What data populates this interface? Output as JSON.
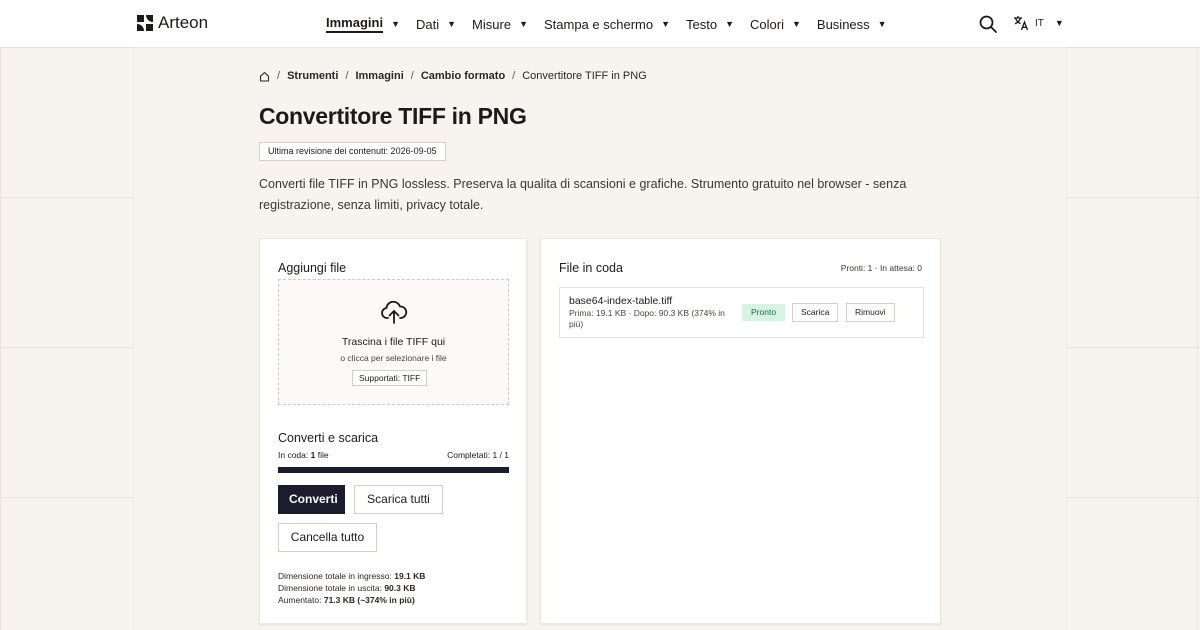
{
  "header": {
    "brand": "Arteon",
    "nav": [
      {
        "label": "Immagini",
        "active": true
      },
      {
        "label": "Dati",
        "active": false
      },
      {
        "label": "Misure",
        "active": false
      },
      {
        "label": "Stampa e schermo",
        "active": false
      },
      {
        "label": "Testo",
        "active": false
      },
      {
        "label": "Colori",
        "active": false
      },
      {
        "label": "Business",
        "active": false
      }
    ],
    "language": "IT"
  },
  "breadcrumb": {
    "items": [
      "Strumenti",
      "Immagini",
      "Cambio formato"
    ],
    "current": "Convertitore TIFF in PNG"
  },
  "page": {
    "title": "Convertitore TIFF in PNG",
    "revision": "Ultima revisione dei contenuti: 2026-09-05",
    "description": "Converti file TIFF in PNG lossless. Preserva la qualita di scansioni e grafiche. Strumento gratuito nel browser - senza registrazione, senza limiti, privacy totale."
  },
  "upload": {
    "heading": "Aggiungi file",
    "drop_title": "Trascina i file TIFF qui",
    "drop_sub": "o clicca per selezionare i file",
    "supported": "Supportati: TIFF"
  },
  "convert": {
    "heading": "Converti e scarica",
    "queued_label": "In coda: ",
    "queued_value": "1",
    "queued_unit": " file",
    "completed": "Completati: 1 / 1",
    "progress": 1.0,
    "convert_label": "Converti",
    "download_all_label": "Scarica tutti",
    "clear_label": "Cancella tutto",
    "totals": {
      "input_label": "Dimensione totale in ingresso: ",
      "input_value": "19.1 KB",
      "output_label": "Dimensione totale in uscita: ",
      "output_value": "90.3 KB",
      "increase_label": "Aumentato: ",
      "increase_value": "71.3 KB (~374% in più)"
    }
  },
  "queue": {
    "heading": "File in coda",
    "counts": "Pronti: 1 · In attesa: 0",
    "files": [
      {
        "name": "base64-index-table.tiff",
        "meta": "Prima: 19.1 KB · Dopo: 90.3 KB (374% in più)",
        "status": "Pronto",
        "download_label": "Scarica",
        "remove_label": "Rimuovi"
      }
    ]
  },
  "colors": {
    "accent": "#1d1b2e",
    "status_ready_bg": "#d6f3e3",
    "status_ready_text": "#1e6b43"
  },
  "icons": [
    "home-icon",
    "search-icon",
    "translate-icon",
    "cloud-upload-icon",
    "chevron-down-icon"
  ]
}
